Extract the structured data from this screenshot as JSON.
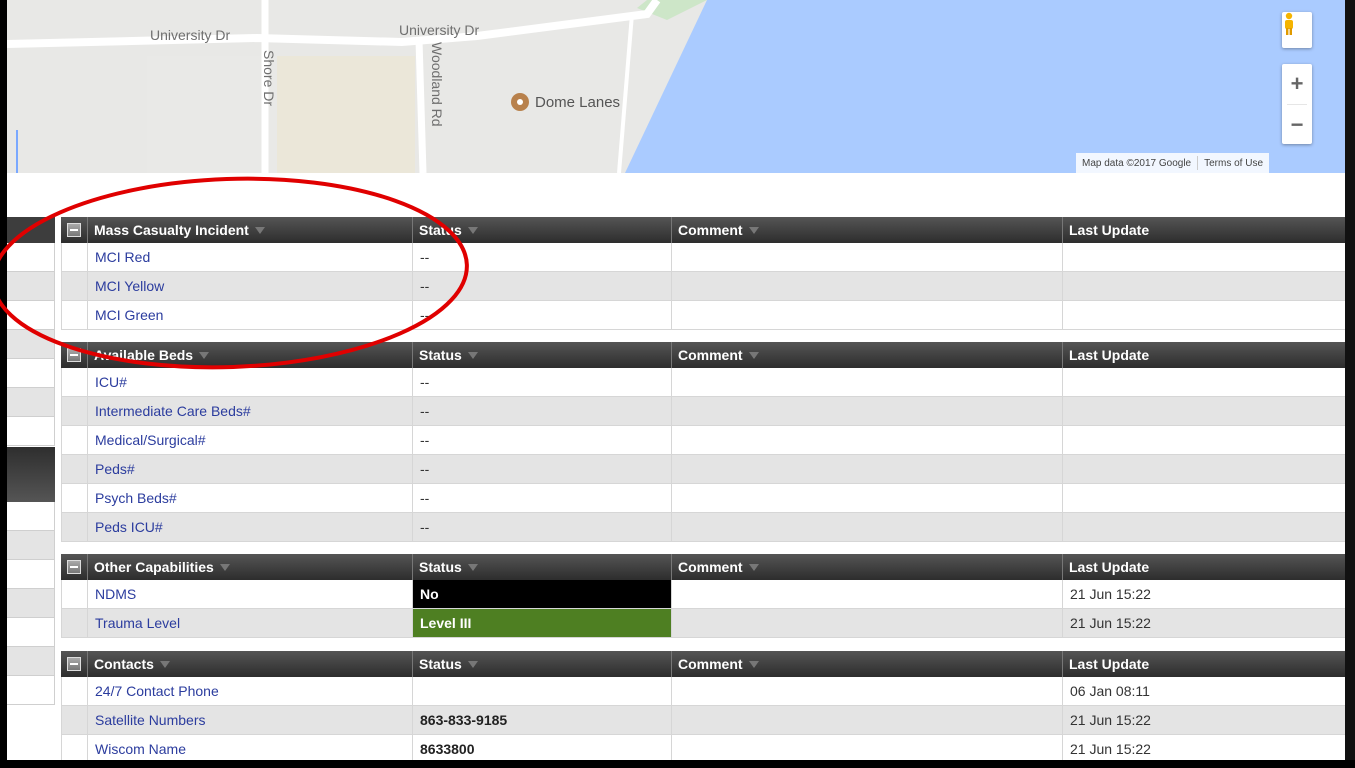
{
  "map": {
    "labels": {
      "road1": "University Dr",
      "road2": "University Dr",
      "road3": "Shore Dr",
      "road4": "Woodland Rd"
    },
    "poi": "Dome Lanes",
    "zoom_in": "+",
    "zoom_out": "−",
    "attribution": "Map data ©2017 Google",
    "terms": "Terms of Use"
  },
  "columns": {
    "status": "Status",
    "comment": "Comment",
    "last_update": "Last Update"
  },
  "sections": {
    "mci": {
      "title": "Mass Casualty Incident",
      "rows": [
        {
          "name": "MCI Red",
          "status": "--",
          "comment": "",
          "updated": ""
        },
        {
          "name": "MCI Yellow",
          "status": "--",
          "comment": "",
          "updated": ""
        },
        {
          "name": "MCI Green",
          "status": "--",
          "comment": "",
          "updated": ""
        }
      ]
    },
    "beds": {
      "title": "Available Beds",
      "rows": [
        {
          "name": "ICU#",
          "status": "--",
          "comment": "",
          "updated": ""
        },
        {
          "name": "Intermediate Care Beds#",
          "status": "--",
          "comment": "",
          "updated": ""
        },
        {
          "name": "Medical/Surgical#",
          "status": "--",
          "comment": "",
          "updated": ""
        },
        {
          "name": "Peds#",
          "status": "--",
          "comment": "",
          "updated": ""
        },
        {
          "name": "Psych Beds#",
          "status": "--",
          "comment": "",
          "updated": ""
        },
        {
          "name": "Peds ICU#",
          "status": "--",
          "comment": "",
          "updated": ""
        }
      ]
    },
    "other": {
      "title": "Other Capabilities",
      "rows": [
        {
          "name": "NDMS",
          "status": "No",
          "comment": "",
          "updated": "21 Jun 15:22"
        },
        {
          "name": "Trauma Level",
          "status": "Level III",
          "comment": "",
          "updated": "21 Jun 15:22"
        }
      ]
    },
    "contacts": {
      "title": "Contacts",
      "rows": [
        {
          "name": "24/7 Contact Phone",
          "status": "",
          "comment": "",
          "updated": "06 Jan 08:11"
        },
        {
          "name": "Satellite Numbers",
          "status": "863-833-9185",
          "comment": "",
          "updated": "21 Jun 15:22"
        },
        {
          "name": "Wiscom Name",
          "status": "8633800",
          "comment": "",
          "updated": "21 Jun 15:22"
        }
      ]
    }
  },
  "colors": {
    "header_bg": "#3a3a3a",
    "link": "#2b3c9e",
    "status_no_bg": "#000000",
    "status_level_bg": "#4e7f22",
    "annotation": "#e00000",
    "water": "#aacbff"
  },
  "icons": [
    "pegman-icon",
    "collapse-icon",
    "sort-arrow-icon",
    "poi-marker-icon"
  ]
}
